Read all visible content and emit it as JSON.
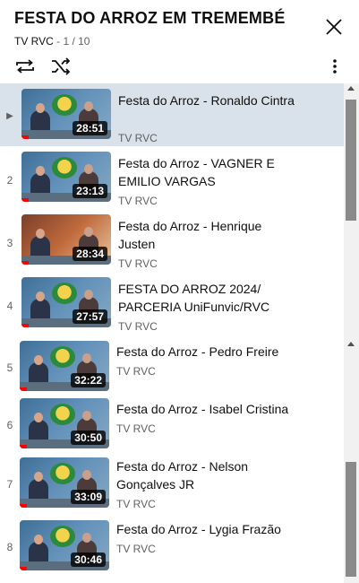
{
  "header": {
    "title": "FESTA DO ARROZ EM TREMEMBÉ",
    "channel": "TV RVC",
    "position": " - 1 / 10"
  },
  "controls": {
    "loop_icon": "loop-icon",
    "shuffle_icon": "shuffle-icon",
    "more_icon": "more-vert-icon",
    "close_icon": "close-icon"
  },
  "videos": [
    {
      "index": "▶",
      "title": "Festa do Arroz - Ronaldo Cintra",
      "channel": "TV RVC",
      "duration": "28:51"
    },
    {
      "index": "2",
      "title": "Festa do Arroz - VAGNER E EMILIO VARGAS",
      "channel": "TV RVC",
      "duration": "23:13"
    },
    {
      "index": "3",
      "title": "Festa do Arroz - Henrique Justen",
      "channel": "TV RVC",
      "duration": "28:34"
    },
    {
      "index": "4",
      "title": "FESTA DO ARROZ 2024/ PARCERIA UniFunvic/RVC",
      "channel": "TV RVC",
      "duration": "27:57"
    },
    {
      "index": "5",
      "title": "Festa do Arroz - Pedro Freire",
      "channel": "TV RVC",
      "duration": "32:22"
    },
    {
      "index": "6",
      "title": "Festa do Arroz - Isabel Cristina",
      "channel": "TV RVC",
      "duration": "30:50"
    },
    {
      "index": "7",
      "title": "Festa do Arroz - Nelson Gonçalves JR",
      "channel": "TV RVC",
      "duration": "33:09"
    },
    {
      "index": "8",
      "title": "Festa do Arroz - Lygia Frazão",
      "channel": "TV RVC",
      "duration": "30:46"
    }
  ],
  "colors": {
    "active_row": "#d9e2ea",
    "progress": "#ff0000"
  }
}
